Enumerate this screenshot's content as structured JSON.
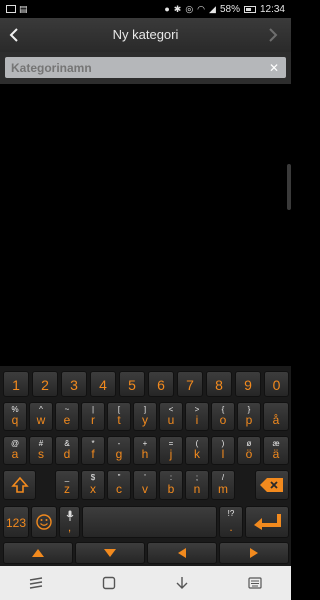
{
  "status_bar": {
    "battery": "58%",
    "time": "12:34"
  },
  "header": {
    "title": "Ny kategori"
  },
  "input": {
    "placeholder": "Kategorinamn",
    "value": ""
  },
  "keyboard": {
    "number_row": [
      "1",
      "2",
      "3",
      "4",
      "5",
      "6",
      "7",
      "8",
      "9",
      "0"
    ],
    "row1": [
      {
        "alt": "%",
        "main": "q"
      },
      {
        "alt": "^",
        "main": "w"
      },
      {
        "alt": "~",
        "main": "e"
      },
      {
        "alt": "|",
        "main": "r"
      },
      {
        "alt": "[",
        "main": "t"
      },
      {
        "alt": "]",
        "main": "y"
      },
      {
        "alt": "<",
        "main": "u"
      },
      {
        "alt": ">",
        "main": "i"
      },
      {
        "alt": "{",
        "main": "o"
      },
      {
        "alt": "}",
        "main": "p"
      },
      {
        "alt": "",
        "main": "å"
      }
    ],
    "row2": [
      {
        "alt": "@",
        "main": "a"
      },
      {
        "alt": "#",
        "main": "s"
      },
      {
        "alt": "&",
        "main": "d"
      },
      {
        "alt": "*",
        "main": "f"
      },
      {
        "alt": "-",
        "main": "g"
      },
      {
        "alt": "+",
        "main": "h"
      },
      {
        "alt": "=",
        "main": "j"
      },
      {
        "alt": "(",
        "main": "k"
      },
      {
        "alt": ")",
        "main": "l"
      },
      {
        "alt": "ø",
        "main": "ö"
      },
      {
        "alt": "æ",
        "main": "ä"
      }
    ],
    "row3": [
      {
        "alt": "_",
        "main": "z"
      },
      {
        "alt": "$",
        "main": "x"
      },
      {
        "alt": "\"",
        "main": "c"
      },
      {
        "alt": "'",
        "main": "v"
      },
      {
        "alt": ":",
        "main": "b"
      },
      {
        "alt": ";",
        "main": "n"
      },
      {
        "alt": "/",
        "main": "m"
      },
      {
        "alt": "!?",
        "main": "."
      }
    ],
    "symbols_label": "123",
    "mic_comma": ","
  },
  "colors": {
    "accent": "#f28a1e",
    "key_face": "#2f2f2f",
    "input_bg": "#b5b7ba"
  }
}
